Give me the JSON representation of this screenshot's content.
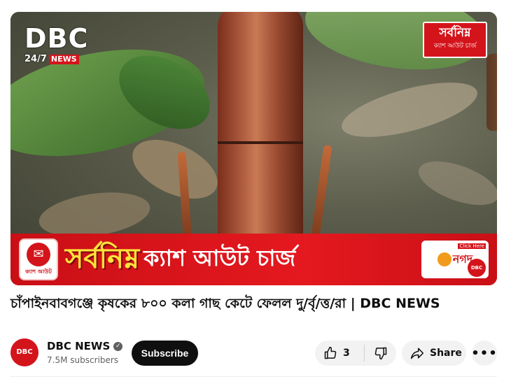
{
  "video": {
    "logo_main": "DBC",
    "logo_247": "24/7",
    "logo_news": "NEWS",
    "promo_line1": "সর্বনিম্ন",
    "promo_line2": "ক্যাশ আউট চার্জ",
    "banner_headline": "সর্বনিম্ন",
    "banner_headline2": "ক্যাশ আউট চার্জ",
    "banner_cash_label": "ক্যাশ আউট",
    "banner_brand": "নগদ",
    "banner_click": "Click Here",
    "banner_mini_logo": "DBC"
  },
  "title": "চাঁপাইনবাবগঞ্জে কৃষকের ৮০০ কলা গাছ কেটে ফেলল দু/র্বৃ/ত্ত/রা | DBC NEWS",
  "channel": {
    "avatar_text": "DBC",
    "name": "DBC NEWS",
    "subscribers": "7.5M subscribers",
    "subscribe_label": "Subscribe"
  },
  "actions": {
    "like_count": "3",
    "share_label": "Share",
    "more_label": "•••"
  },
  "colors": {
    "brand_red": "#d4141b",
    "banner_yellow": "#ffe23b"
  },
  "icons": {
    "like": "thumbs-up-icon",
    "dislike": "thumbs-down-icon",
    "share": "share-arrow-icon",
    "verified": "verified-check-icon",
    "more": "more-horizontal-icon"
  }
}
